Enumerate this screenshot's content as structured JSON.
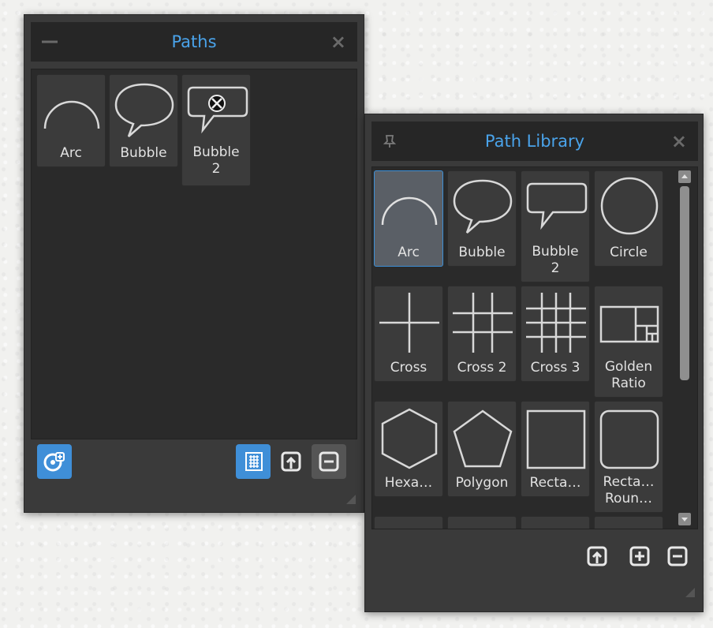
{
  "paths_panel": {
    "title": "Paths",
    "items": [
      {
        "label": "Arc",
        "icon": "arc-icon"
      },
      {
        "label": "Bubble",
        "icon": "bubble-icon"
      },
      {
        "label": "Bubble\n2",
        "icon": "bubble-2-icon"
      }
    ],
    "toolbar": [
      "add-to-library-icon",
      "grid-view-icon",
      "import-icon",
      "remove-icon"
    ]
  },
  "library_panel": {
    "title": "Path Library",
    "items": [
      {
        "label": "Arc",
        "icon": "arc-icon",
        "selected": true
      },
      {
        "label": "Bubble",
        "icon": "bubble-icon"
      },
      {
        "label": "Bubble\n2",
        "icon": "bubble-2-icon"
      },
      {
        "label": "Circle",
        "icon": "circle-icon"
      },
      {
        "label": "Cross",
        "icon": "cross-icon"
      },
      {
        "label": "Cross 2",
        "icon": "cross-2-icon"
      },
      {
        "label": "Cross 3",
        "icon": "cross-3-icon"
      },
      {
        "label": "Golden\nRatio",
        "icon": "golden-ratio-icon"
      },
      {
        "label": "Hexa…",
        "icon": "hexagon-icon"
      },
      {
        "label": "Polygon",
        "icon": "polygon-icon"
      },
      {
        "label": "Recta…",
        "icon": "rectangle-icon"
      },
      {
        "label": "Recta…\nRoun…",
        "icon": "rounded-rectangle-icon"
      }
    ],
    "toolbar": [
      "import-icon",
      "add-icon",
      "remove-icon"
    ]
  },
  "colors": {
    "accent": "#4aa3ea",
    "panel_bg": "#3a3a3a",
    "title_bg": "#262626",
    "tile_bg": "#3b3b3b",
    "tile_selected_bg": "#5a5f66"
  }
}
